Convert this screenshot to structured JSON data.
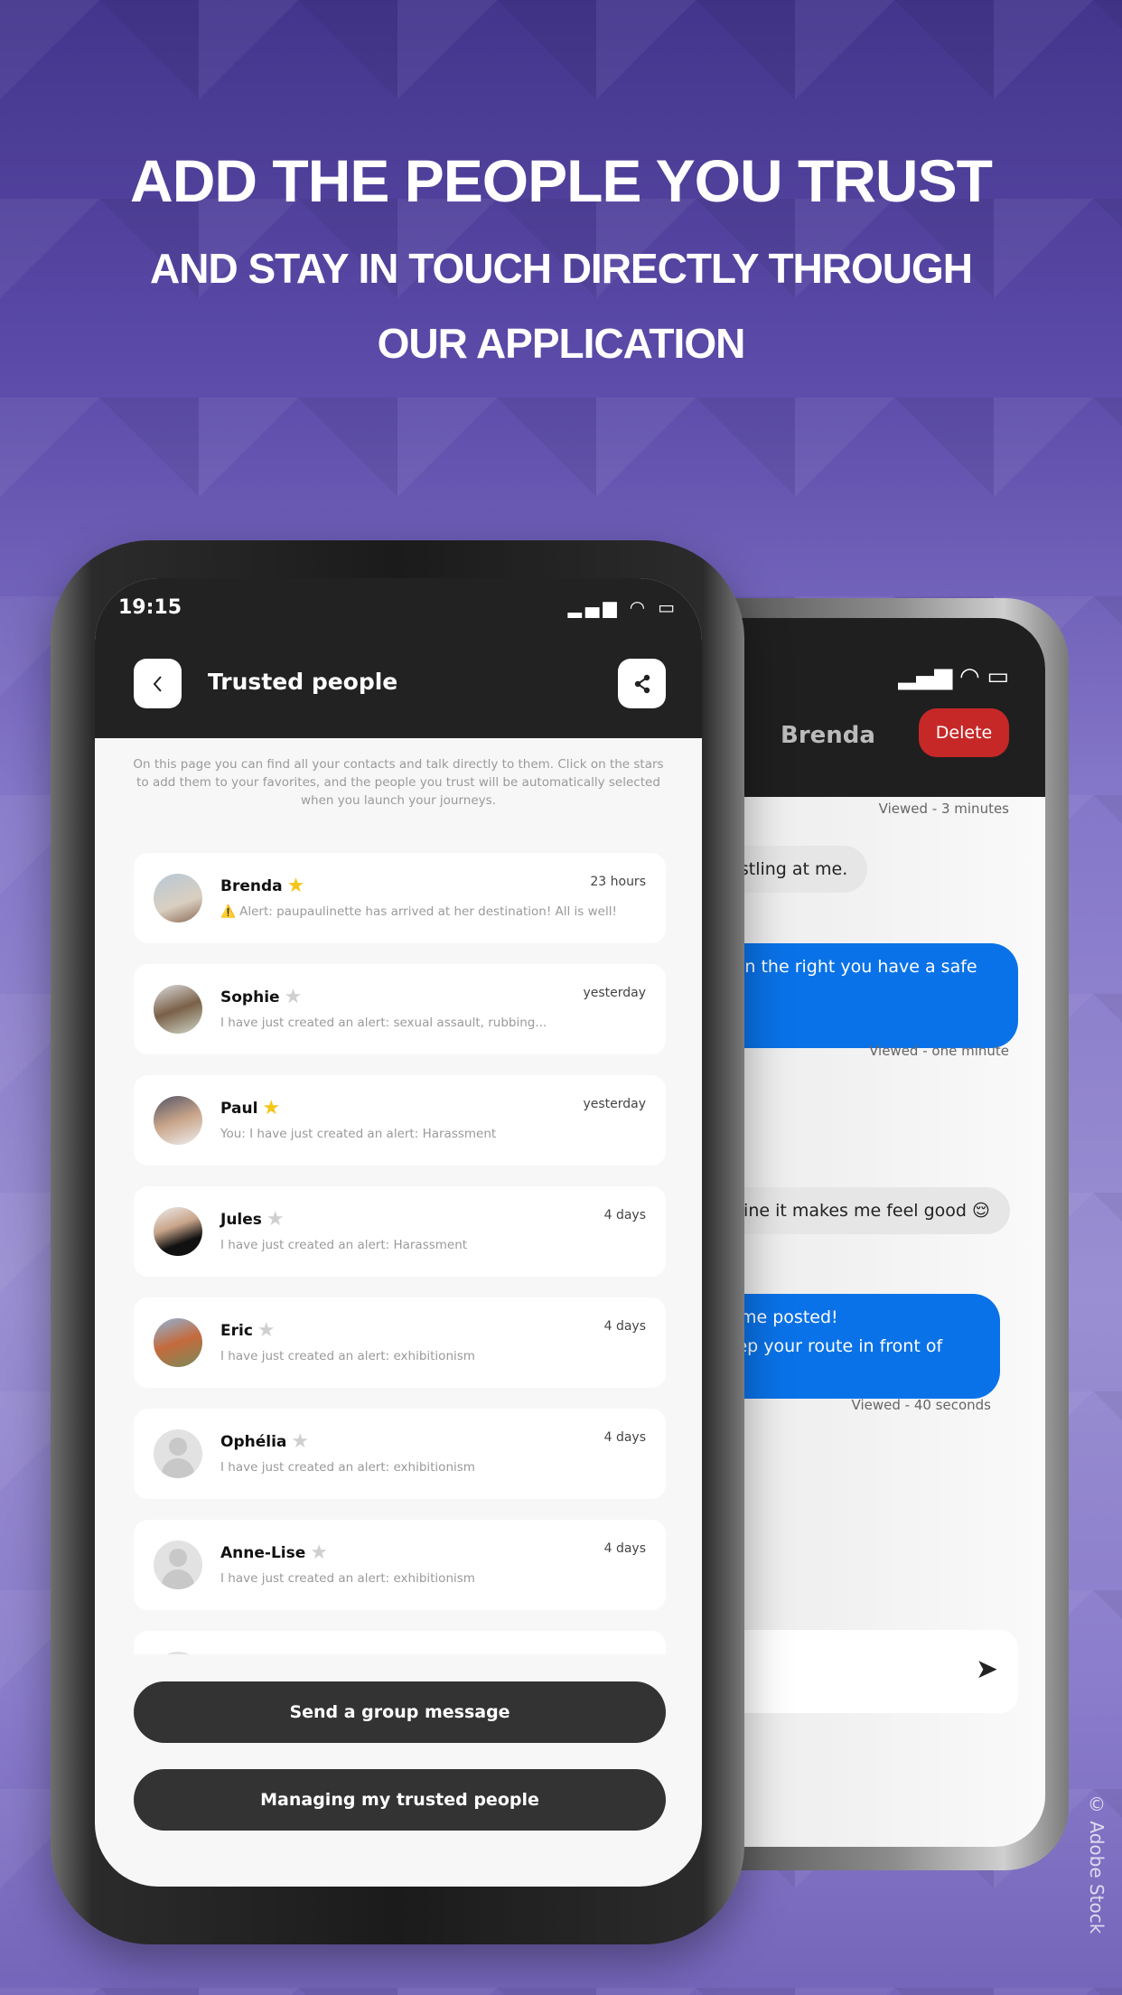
{
  "headline": {
    "line1": "ADD THE PEOPLE YOU TRUST",
    "line2": "AND STAY IN TOUCH DIRECTLY THROUGH",
    "line3": "OUR APPLICATION"
  },
  "front": {
    "status": {
      "time": "19:15",
      "icons": "signal wifi battery"
    },
    "header": {
      "title": "Trusted people",
      "back_icon": "chevron-left-icon",
      "share_icon": "share-icon"
    },
    "description": "On this page you can find all your contacts and talk directly to them. Click on the stars to add them to your favorites, and the people you trust will be automatically selected when you launch your journeys.",
    "contacts": [
      {
        "name": "Brenda",
        "favorite": true,
        "time": "23 hours",
        "preview": "Alert: paupaulinette has arrived at her destination! All is well!",
        "warning": "⚠️",
        "avatar": "photo"
      },
      {
        "name": "Sophie",
        "favorite": false,
        "time": "yesterday",
        "preview": "I have just created an alert: sexual assault, rubbing...",
        "avatar": "photo"
      },
      {
        "name": "Paul",
        "favorite": true,
        "time": "yesterday",
        "preview": "You: I have just created an alert: Harassment",
        "avatar": "photo"
      },
      {
        "name": "Jules",
        "favorite": false,
        "time": "4 days",
        "preview": "I have just created an alert: Harassment",
        "avatar": "photo"
      },
      {
        "name": "Eric",
        "favorite": false,
        "time": "4 days",
        "preview": "I have just created an alert: exhibitionism",
        "avatar": "photo"
      },
      {
        "name": "Ophélia",
        "favorite": false,
        "time": "4 days",
        "preview": "I have just created an alert: exhibitionism",
        "avatar": "default"
      },
      {
        "name": "Anne-Lise",
        "favorite": false,
        "time": "4 days",
        "preview": "I have just created an alert: exhibitionism",
        "avatar": "default"
      }
    ],
    "buttons": {
      "group": "Send a group message",
      "manage": "Managing my trusted people"
    },
    "colors": {
      "star_on": "#f5c518",
      "star_off": "#cfcfcf",
      "appbar": "#222222",
      "button": "#333333"
    }
  },
  "back": {
    "header": {
      "name": "Brenda",
      "delete": "Delete"
    },
    "messages": [
      {
        "meta": "Viewed - 3 minutes"
      },
      {
        "type": "received",
        "text": "whistling at me."
      },
      {
        "type": "sent",
        "text": "eets on the right you have a safe bar",
        "text2": "ed."
      },
      {
        "meta": "Viewed - one minute"
      },
      {
        "type": "received",
        "text": "g online it makes me feel good 😌"
      },
      {
        "type": "sent",
        "text": "Keep me posted!",
        "text2": "I'll keep your route in front of me."
      },
      {
        "meta": "Viewed - 40 seconds"
      }
    ],
    "send_icon": "paper-plane-icon",
    "colors": {
      "delete": "#c62828",
      "sent_bubble": "#0a72e8"
    }
  },
  "watermark": "© Adobe Stock"
}
